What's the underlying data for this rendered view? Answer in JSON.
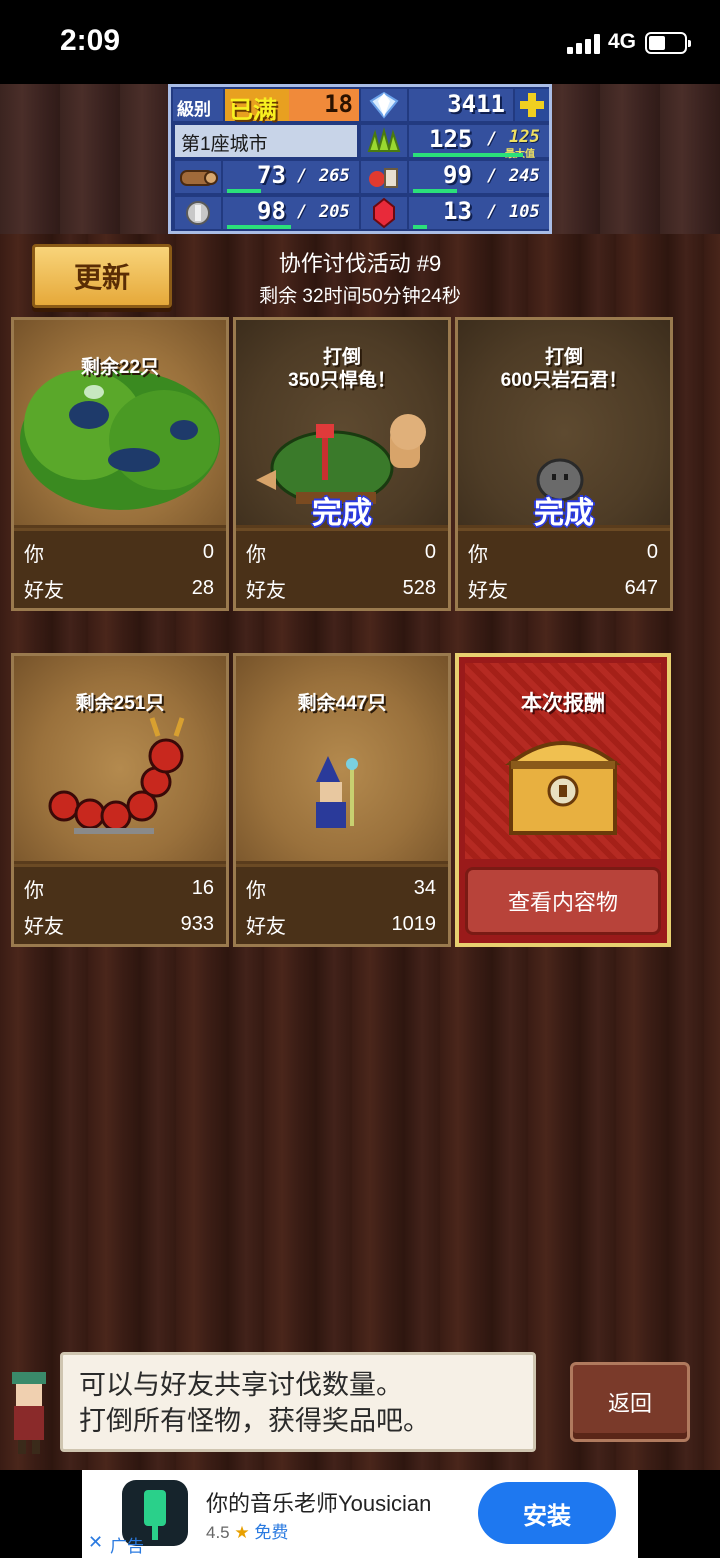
{
  "status_bar": {
    "time": "2:09",
    "network": "4G"
  },
  "hud": {
    "level_label": "級别",
    "level_badge": "已满",
    "level_value": "18",
    "gems": "3411",
    "city": "第1座城市",
    "grass_current": "125",
    "grass_max": "125",
    "grass_note": "最大值",
    "wood_current": "73",
    "wood_max": "265",
    "food_current": "99",
    "food_max": "245",
    "ore_current": "98",
    "ore_max": "205",
    "ruby_current": "13",
    "ruby_max": "105",
    "sep": "/"
  },
  "header": {
    "refresh_label": "更新",
    "event_title": "协作讨伐活动 #9",
    "event_time": "剩余 32时间50分钟24秒"
  },
  "row_labels": {
    "you": "你",
    "friends": "好友"
  },
  "cards": [
    {
      "label": "剩余22只",
      "done": "",
      "you": "0",
      "friends": "28"
    },
    {
      "label": "打倒\n350只悍龟！",
      "label_line1": "打倒",
      "label_line2": "350只悍龟！",
      "done": "完成",
      "you": "0",
      "friends": "528"
    },
    {
      "label_line1": "打倒",
      "label_line2": "600只岩石君！",
      "done": "完成",
      "you": "0",
      "friends": "647"
    },
    {
      "label": "剩余251只",
      "done": "",
      "you": "16",
      "friends": "933"
    },
    {
      "label": "剩余447只",
      "done": "",
      "you": "34",
      "friends": "1019"
    }
  ],
  "reward": {
    "title": "本次报酬",
    "button": "查看内容物"
  },
  "message": {
    "line1": "可以与好友共享讨伐数量。",
    "line2": "打倒所有怪物，获得奖品吧。"
  },
  "back_label": "返回",
  "ad": {
    "title": "你的音乐老师Yousician",
    "rating": "4.5",
    "price": "免费",
    "install": "安装",
    "tag": "广告"
  },
  "colors": {
    "hud_bg": "#223a80",
    "done_outline": "#2a3ae0",
    "install_blue": "#1e78f0"
  }
}
